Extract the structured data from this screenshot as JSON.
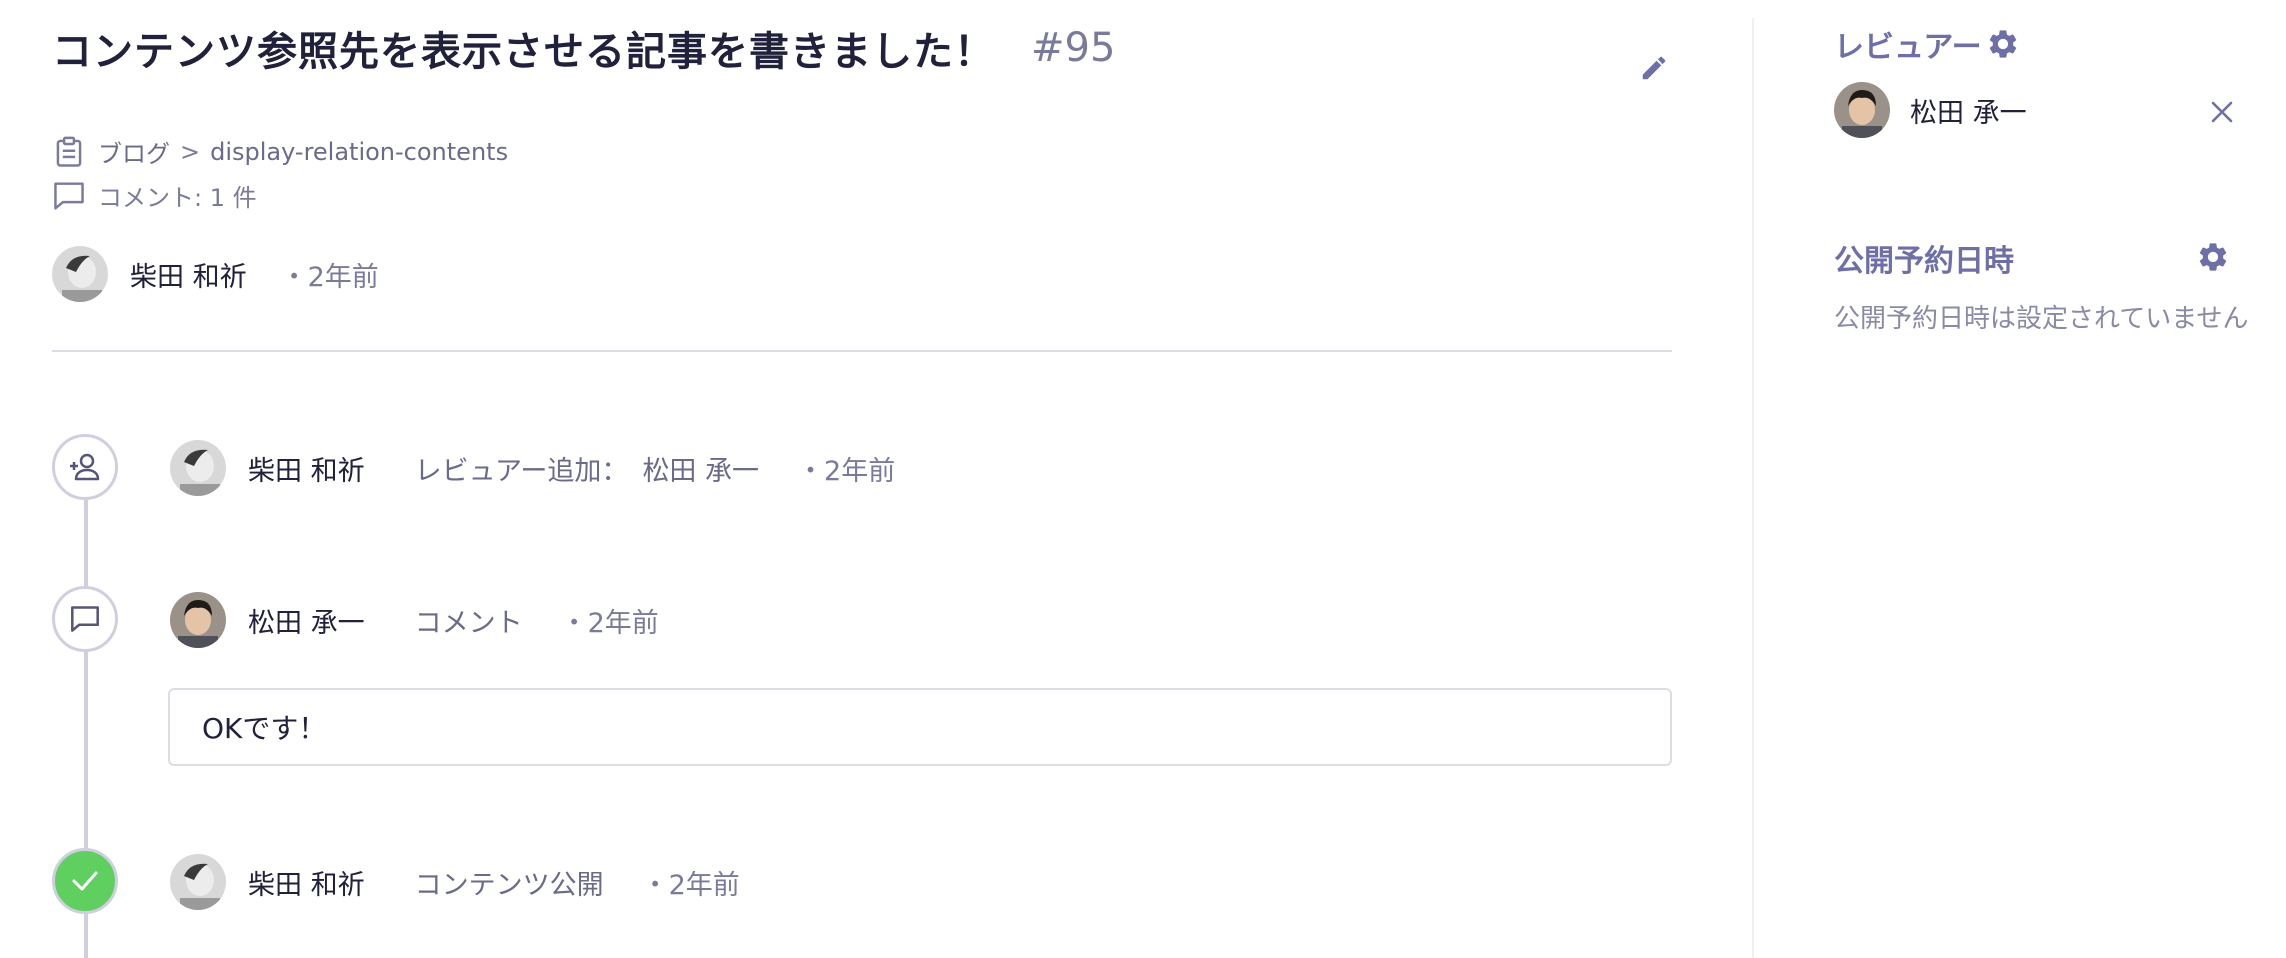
{
  "article": {
    "title": "コンテンツ参照先を表示させる記事を書きました！",
    "number": "#95",
    "breadcrumb_api": "ブログ",
    "breadcrumb_separator": ">",
    "breadcrumb_content_id": "display-relation-contents",
    "comment_count": "コメント: 1 件",
    "author_name": "柴田 和祈",
    "created_ago": "・2年前"
  },
  "timeline": [
    {
      "icon": "person-add-icon",
      "user": "柴田 和祈",
      "action": "レビュアー追加：",
      "target": "松田 承一",
      "time": "・2年前"
    },
    {
      "icon": "comment-icon",
      "user": "松田 承一",
      "action": "コメント",
      "time": "・2年前",
      "comment": "OKです！"
    },
    {
      "icon": "check-icon",
      "user": "柴田 和祈",
      "action": "コンテンツ公開",
      "time": "・2年前"
    }
  ],
  "sidebar": {
    "reviewers_title": "レビュアー",
    "reviewers": [
      {
        "name": "松田 承一"
      }
    ],
    "schedule_title": "公開予約日時",
    "schedule_empty": "公開予約日時は設定されていません"
  },
  "colors": {
    "accent": "#6f6fa8",
    "text": "#21213b",
    "muted": "#7a7a9a",
    "published_green": "#5fcf5f",
    "timeline_line": "#cfcfdf"
  }
}
